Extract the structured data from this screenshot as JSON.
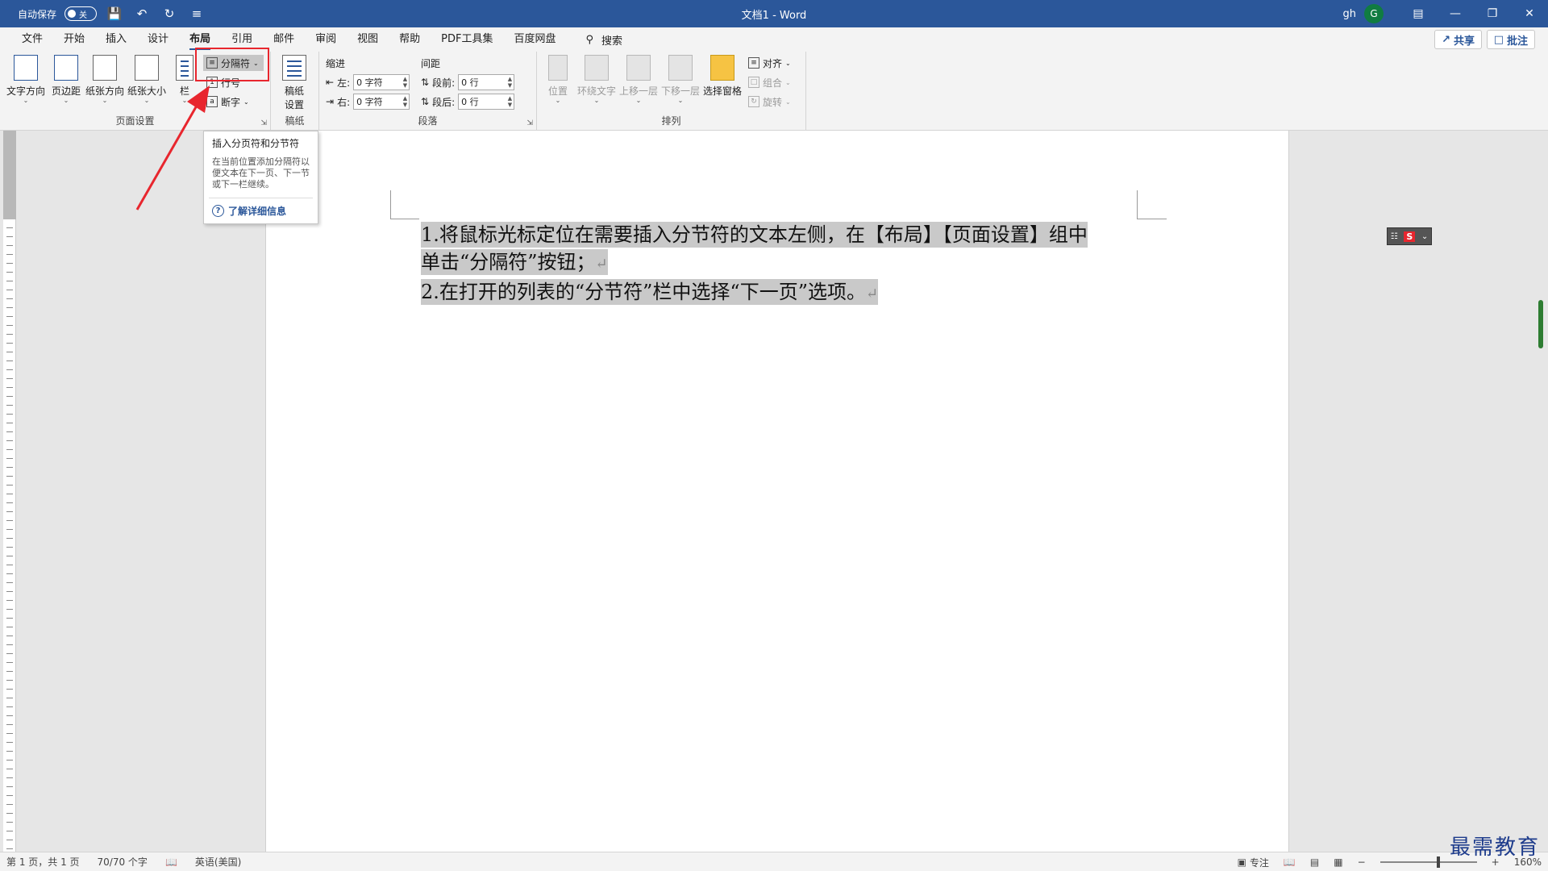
{
  "titlebar": {
    "autosave_label": "自动保存",
    "autosave_toggle": "关",
    "document_title": "文档1 - Word",
    "user_name": "gh",
    "avatar_initial": "G"
  },
  "menu": {
    "tabs": [
      "文件",
      "开始",
      "插入",
      "设计",
      "布局",
      "引用",
      "邮件",
      "审阅",
      "视图",
      "帮助",
      "PDF工具集",
      "百度网盘"
    ],
    "active_tab": "布局",
    "search_label": "搜索",
    "share_label": "共享",
    "comment_label": "批注"
  },
  "ribbon": {
    "page_setup": {
      "label": "页面设置",
      "text_direction": "文字方向",
      "margins": "页边距",
      "orientation": "纸张方向",
      "size": "纸张大小",
      "columns": "栏",
      "breaks": "分隔符",
      "line_numbers": "行号",
      "hyphenation": "断字"
    },
    "manuscript": {
      "label": "稿纸",
      "button_line1": "稿纸",
      "button_line2": "设置"
    },
    "paragraph": {
      "label": "段落",
      "indent_header": "缩进",
      "spacing_header": "间距",
      "left_label": "左:",
      "left_value": "0 字符",
      "right_label": "右:",
      "right_value": "0 字符",
      "before_label": "段前:",
      "before_value": "0 行",
      "after_label": "段后:",
      "after_value": "0 行"
    },
    "arrange": {
      "label": "排列",
      "position": "位置",
      "wrap_text": "环绕文字",
      "bring_forward": "上移一层",
      "send_backward": "下移一层",
      "selection_pane": "选择窗格",
      "align": "对齐",
      "group": "组合",
      "rotate": "旋转"
    }
  },
  "tooltip": {
    "title": "插入分页符和分节符",
    "description": "在当前位置添加分隔符以便文本在下一页、下一节或下一栏继续。",
    "link": "了解详细信息"
  },
  "document": {
    "line1": "1.将鼠标光标定位在需要插入分节符的文本左侧，在【布局】【页面设置】组中",
    "line2": "单击“分隔符”按钮；",
    "line3": "2.在打开的列表的“分节符”栏中选择“下一页”选项。",
    "paragraph_mark": "↵"
  },
  "statusbar": {
    "page_info": "第 1 页，共 1 页",
    "word_count": "70/70 个字",
    "language": "英语(美国)",
    "focus": "专注",
    "zoom": "160%"
  },
  "watermark": "最需教育",
  "colors": {
    "title_blue": "#2b579a",
    "highlight_red": "#e8262e",
    "selection_gray": "#c9c9c9"
  }
}
